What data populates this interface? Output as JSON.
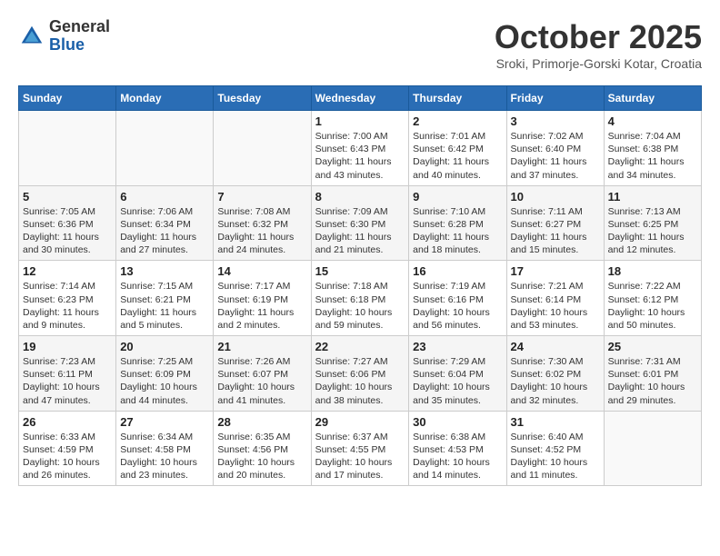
{
  "logo": {
    "general": "General",
    "blue": "Blue"
  },
  "title": "October 2025",
  "subtitle": "Sroki, Primorje-Gorski Kotar, Croatia",
  "days_of_week": [
    "Sunday",
    "Monday",
    "Tuesday",
    "Wednesday",
    "Thursday",
    "Friday",
    "Saturday"
  ],
  "weeks": [
    [
      {
        "day": "",
        "info": ""
      },
      {
        "day": "",
        "info": ""
      },
      {
        "day": "",
        "info": ""
      },
      {
        "day": "1",
        "info": "Sunrise: 7:00 AM\nSunset: 6:43 PM\nDaylight: 11 hours\nand 43 minutes."
      },
      {
        "day": "2",
        "info": "Sunrise: 7:01 AM\nSunset: 6:42 PM\nDaylight: 11 hours\nand 40 minutes."
      },
      {
        "day": "3",
        "info": "Sunrise: 7:02 AM\nSunset: 6:40 PM\nDaylight: 11 hours\nand 37 minutes."
      },
      {
        "day": "4",
        "info": "Sunrise: 7:04 AM\nSunset: 6:38 PM\nDaylight: 11 hours\nand 34 minutes."
      }
    ],
    [
      {
        "day": "5",
        "info": "Sunrise: 7:05 AM\nSunset: 6:36 PM\nDaylight: 11 hours\nand 30 minutes."
      },
      {
        "day": "6",
        "info": "Sunrise: 7:06 AM\nSunset: 6:34 PM\nDaylight: 11 hours\nand 27 minutes."
      },
      {
        "day": "7",
        "info": "Sunrise: 7:08 AM\nSunset: 6:32 PM\nDaylight: 11 hours\nand 24 minutes."
      },
      {
        "day": "8",
        "info": "Sunrise: 7:09 AM\nSunset: 6:30 PM\nDaylight: 11 hours\nand 21 minutes."
      },
      {
        "day": "9",
        "info": "Sunrise: 7:10 AM\nSunset: 6:28 PM\nDaylight: 11 hours\nand 18 minutes."
      },
      {
        "day": "10",
        "info": "Sunrise: 7:11 AM\nSunset: 6:27 PM\nDaylight: 11 hours\nand 15 minutes."
      },
      {
        "day": "11",
        "info": "Sunrise: 7:13 AM\nSunset: 6:25 PM\nDaylight: 11 hours\nand 12 minutes."
      }
    ],
    [
      {
        "day": "12",
        "info": "Sunrise: 7:14 AM\nSunset: 6:23 PM\nDaylight: 11 hours\nand 9 minutes."
      },
      {
        "day": "13",
        "info": "Sunrise: 7:15 AM\nSunset: 6:21 PM\nDaylight: 11 hours\nand 5 minutes."
      },
      {
        "day": "14",
        "info": "Sunrise: 7:17 AM\nSunset: 6:19 PM\nDaylight: 11 hours\nand 2 minutes."
      },
      {
        "day": "15",
        "info": "Sunrise: 7:18 AM\nSunset: 6:18 PM\nDaylight: 10 hours\nand 59 minutes."
      },
      {
        "day": "16",
        "info": "Sunrise: 7:19 AM\nSunset: 6:16 PM\nDaylight: 10 hours\nand 56 minutes."
      },
      {
        "day": "17",
        "info": "Sunrise: 7:21 AM\nSunset: 6:14 PM\nDaylight: 10 hours\nand 53 minutes."
      },
      {
        "day": "18",
        "info": "Sunrise: 7:22 AM\nSunset: 6:12 PM\nDaylight: 10 hours\nand 50 minutes."
      }
    ],
    [
      {
        "day": "19",
        "info": "Sunrise: 7:23 AM\nSunset: 6:11 PM\nDaylight: 10 hours\nand 47 minutes."
      },
      {
        "day": "20",
        "info": "Sunrise: 7:25 AM\nSunset: 6:09 PM\nDaylight: 10 hours\nand 44 minutes."
      },
      {
        "day": "21",
        "info": "Sunrise: 7:26 AM\nSunset: 6:07 PM\nDaylight: 10 hours\nand 41 minutes."
      },
      {
        "day": "22",
        "info": "Sunrise: 7:27 AM\nSunset: 6:06 PM\nDaylight: 10 hours\nand 38 minutes."
      },
      {
        "day": "23",
        "info": "Sunrise: 7:29 AM\nSunset: 6:04 PM\nDaylight: 10 hours\nand 35 minutes."
      },
      {
        "day": "24",
        "info": "Sunrise: 7:30 AM\nSunset: 6:02 PM\nDaylight: 10 hours\nand 32 minutes."
      },
      {
        "day": "25",
        "info": "Sunrise: 7:31 AM\nSunset: 6:01 PM\nDaylight: 10 hours\nand 29 minutes."
      }
    ],
    [
      {
        "day": "26",
        "info": "Sunrise: 6:33 AM\nSunset: 4:59 PM\nDaylight: 10 hours\nand 26 minutes."
      },
      {
        "day": "27",
        "info": "Sunrise: 6:34 AM\nSunset: 4:58 PM\nDaylight: 10 hours\nand 23 minutes."
      },
      {
        "day": "28",
        "info": "Sunrise: 6:35 AM\nSunset: 4:56 PM\nDaylight: 10 hours\nand 20 minutes."
      },
      {
        "day": "29",
        "info": "Sunrise: 6:37 AM\nSunset: 4:55 PM\nDaylight: 10 hours\nand 17 minutes."
      },
      {
        "day": "30",
        "info": "Sunrise: 6:38 AM\nSunset: 4:53 PM\nDaylight: 10 hours\nand 14 minutes."
      },
      {
        "day": "31",
        "info": "Sunrise: 6:40 AM\nSunset: 4:52 PM\nDaylight: 10 hours\nand 11 minutes."
      },
      {
        "day": "",
        "info": ""
      }
    ]
  ]
}
